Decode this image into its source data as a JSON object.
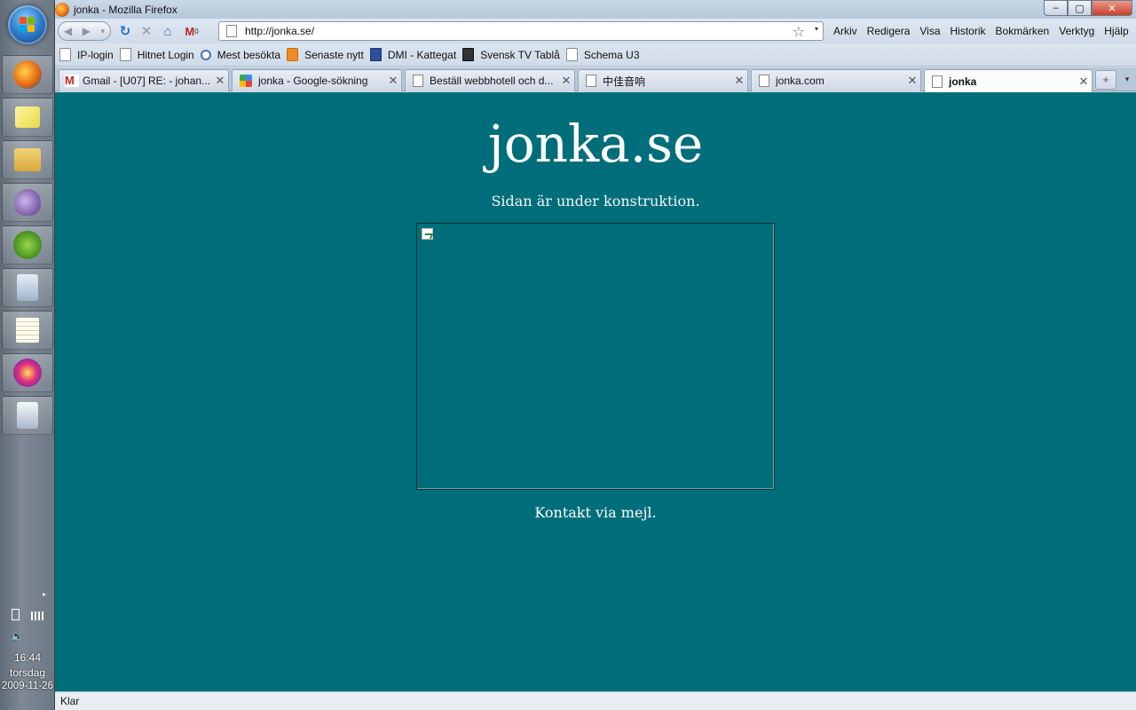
{
  "window": {
    "title": "jonka - Mozilla Firefox",
    "controls": {
      "minimize": "–",
      "maximize": "▢",
      "close": "✕"
    }
  },
  "nav": {
    "back_icon": "◀",
    "forward_icon": "▶",
    "dropdown_icon": "▾",
    "reload_icon": "↻",
    "stop_icon": "✕",
    "home_icon": "⌂",
    "gmail_label": "M",
    "gmail_count": "0",
    "url": "http://jonka.se/",
    "star_icon": "☆",
    "url_dropdown_icon": "▾"
  },
  "menu": [
    "Arkiv",
    "Redigera",
    "Visa",
    "Historik",
    "Bokmärken",
    "Verktyg",
    "Hjälp"
  ],
  "bookmarks": [
    {
      "label": "IP-login",
      "icon": "page"
    },
    {
      "label": "Hitnet Login",
      "icon": "page"
    },
    {
      "label": "Mest besökta",
      "icon": "search"
    },
    {
      "label": "Senaste nytt",
      "icon": "rss"
    },
    {
      "label": "DMI - Kattegat",
      "icon": "crown"
    },
    {
      "label": "Svensk TV Tablå",
      "icon": "tv"
    },
    {
      "label": "Schema U3",
      "icon": "page"
    }
  ],
  "tabs": [
    {
      "label": "Gmail - [U07] RE: - johan...",
      "icon": "gmail",
      "close": "✕"
    },
    {
      "label": "jonka - Google-sökning",
      "icon": "google",
      "close": "✕"
    },
    {
      "label": "Beställ webbhotell och d...",
      "icon": "page",
      "close": "✕"
    },
    {
      "label": "中佳音响",
      "icon": "page",
      "close": "✕"
    },
    {
      "label": "jonka.com",
      "icon": "page",
      "close": "✕"
    },
    {
      "label": "jonka",
      "icon": "page",
      "close": "✕",
      "active": true
    }
  ],
  "tabstrip": {
    "new_tab": "+",
    "list": "▾"
  },
  "page": {
    "title": "jonka.se",
    "subtitle": "Sidan är under konstruktion.",
    "contact": "Kontakt via mejl.",
    "background": "#006e7a"
  },
  "status": {
    "text": "Klar"
  },
  "taskbar": {
    "apps": [
      "firefox-icon",
      "sticky-notes-icon",
      "file-explorer-icon",
      "pidgin-icon",
      "spotify-icon",
      "calculator-icon",
      "notepad-icon",
      "starburst-icon",
      "clipboard-icon"
    ],
    "tray_arrow": "▸",
    "time": "16:44",
    "day": "torsdag",
    "date": "2009-11-26"
  }
}
